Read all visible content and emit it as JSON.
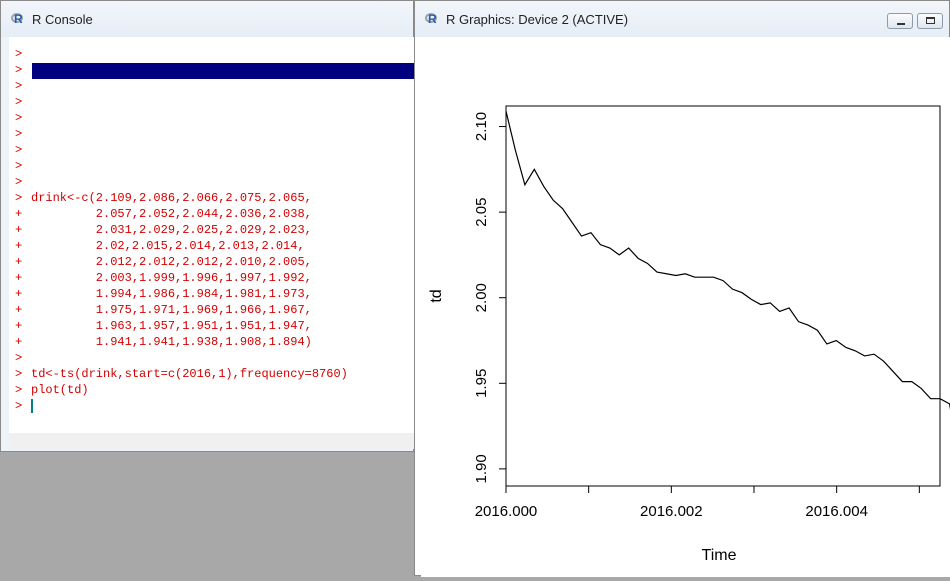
{
  "console": {
    "title": "R Console",
    "lines": [
      {
        "prompt": ">",
        "text": ""
      },
      {
        "prompt": ">",
        "text": ""
      },
      {
        "prompt": ">",
        "text": ""
      },
      {
        "prompt": ">",
        "text": ""
      },
      {
        "prompt": ">",
        "text": ""
      },
      {
        "prompt": ">",
        "text": ""
      },
      {
        "prompt": ">",
        "text": ""
      },
      {
        "prompt": ">",
        "text": ""
      },
      {
        "prompt": ">",
        "text": ""
      },
      {
        "prompt": ">",
        "text": "drink<-c(2.109,2.086,2.066,2.075,2.065,"
      },
      {
        "prompt": "+",
        "text": "         2.057,2.052,2.044,2.036,2.038,"
      },
      {
        "prompt": "+",
        "text": "         2.031,2.029,2.025,2.029,2.023,"
      },
      {
        "prompt": "+",
        "text": "         2.02,2.015,2.014,2.013,2.014,"
      },
      {
        "prompt": "+",
        "text": "         2.012,2.012,2.012,2.010,2.005,"
      },
      {
        "prompt": "+",
        "text": "         2.003,1.999,1.996,1.997,1.992,"
      },
      {
        "prompt": "+",
        "text": "         1.994,1.986,1.984,1.981,1.973,"
      },
      {
        "prompt": "+",
        "text": "         1.975,1.971,1.969,1.966,1.967,"
      },
      {
        "prompt": "+",
        "text": "         1.963,1.957,1.951,1.951,1.947,"
      },
      {
        "prompt": "+",
        "text": "         1.941,1.941,1.938,1.908,1.894)"
      },
      {
        "prompt": ">",
        "text": ""
      },
      {
        "prompt": ">",
        "text": "td<-ts(drink,start=c(2016,1),frequency=8760)"
      },
      {
        "prompt": ">",
        "text": "plot(td)"
      },
      {
        "prompt": ">",
        "text": "",
        "cursor": true
      }
    ]
  },
  "graphics": {
    "title": "R Graphics: Device 2 (ACTIVE)",
    "minimize_label": "minimize",
    "maximize_label": "maximize"
  },
  "colors": {
    "console_text": "#d40000",
    "selection": "#000080",
    "line": "#000000"
  },
  "chart_data": {
    "type": "line",
    "title": "",
    "xlabel": "Time",
    "ylabel": "td",
    "xlim": [
      2016.0,
      2016.00525
    ],
    "ylim": [
      1.89,
      2.112
    ],
    "xticks": [
      2016.0,
      2016.002,
      2016.004
    ],
    "xtick_labels": [
      "2016.000",
      "2016.002",
      "2016.004"
    ],
    "xticks_minor": [
      2016.0,
      2016.001,
      2016.002,
      2016.003,
      2016.004,
      2016.005
    ],
    "yticks": [
      1.9,
      1.95,
      2.0,
      2.05,
      2.1
    ],
    "ytick_labels": [
      "1.90",
      "1.95",
      "2.00",
      "2.05",
      "2.10"
    ],
    "start": 2016.0,
    "frequency": 8760,
    "values": [
      2.109,
      2.086,
      2.066,
      2.075,
      2.065,
      2.057,
      2.052,
      2.044,
      2.036,
      2.038,
      2.031,
      2.029,
      2.025,
      2.029,
      2.023,
      2.02,
      2.015,
      2.014,
      2.013,
      2.014,
      2.012,
      2.012,
      2.012,
      2.01,
      2.005,
      2.003,
      1.999,
      1.996,
      1.997,
      1.992,
      1.994,
      1.986,
      1.984,
      1.981,
      1.973,
      1.975,
      1.971,
      1.969,
      1.966,
      1.967,
      1.963,
      1.957,
      1.951,
      1.951,
      1.947,
      1.941,
      1.941,
      1.938,
      1.908,
      1.894
    ],
    "grid": false,
    "legend": "none"
  }
}
